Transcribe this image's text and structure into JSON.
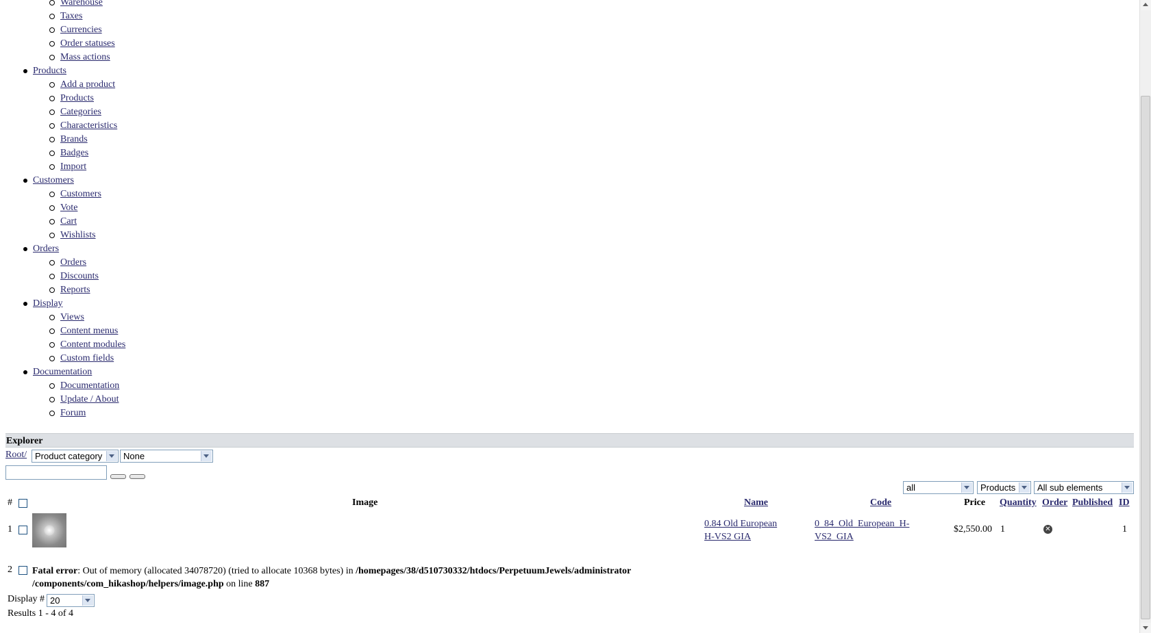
{
  "menu": [
    {
      "label": "Warehouse",
      "level": 2
    },
    {
      "label": "Taxes",
      "level": 2
    },
    {
      "label": "Currencies",
      "level": 2
    },
    {
      "label": "Order statuses",
      "level": 2
    },
    {
      "label": "Mass actions",
      "level": 2
    },
    {
      "label": "Products",
      "level": 1
    },
    {
      "label": "Add a product",
      "level": 2
    },
    {
      "label": "Products",
      "level": 2
    },
    {
      "label": "Categories",
      "level": 2
    },
    {
      "label": "Characteristics",
      "level": 2
    },
    {
      "label": "Brands",
      "level": 2
    },
    {
      "label": "Badges",
      "level": 2
    },
    {
      "label": "Import",
      "level": 2
    },
    {
      "label": "Customers",
      "level": 1
    },
    {
      "label": "Customers",
      "level": 2
    },
    {
      "label": "Vote",
      "level": 2
    },
    {
      "label": "Cart",
      "level": 2
    },
    {
      "label": "Wishlists",
      "level": 2
    },
    {
      "label": "Orders",
      "level": 1
    },
    {
      "label": "Orders",
      "level": 2
    },
    {
      "label": "Discounts",
      "level": 2
    },
    {
      "label": "Reports",
      "level": 2
    },
    {
      "label": "Display",
      "level": 1
    },
    {
      "label": "Views",
      "level": 2
    },
    {
      "label": "Content menus",
      "level": 2
    },
    {
      "label": "Content modules",
      "level": 2
    },
    {
      "label": "Custom fields",
      "level": 2
    },
    {
      "label": "Documentation",
      "level": 1
    },
    {
      "label": "Documentation",
      "level": 2
    },
    {
      "label": "Update / About",
      "level": 2
    },
    {
      "label": "Forum",
      "level": 2
    }
  ],
  "explorer": {
    "title": "Explorer",
    "root_link": "Root/",
    "category_type_select": "Product category",
    "category_select": "None",
    "search_value": ""
  },
  "filters": {
    "published": "all",
    "type": "Products",
    "depth": "All sub elements"
  },
  "table": {
    "headers": {
      "num": "#",
      "image": "Image",
      "name": "Name",
      "code": "Code",
      "price": "Price",
      "quantity": "Quantity",
      "order": "Order",
      "published": "Published",
      "id": "ID"
    },
    "rows": [
      {
        "num": "1",
        "name_line1": "0.84 Old European",
        "name_line2": "H-VS2 GIA",
        "code_line1": "0_84_Old_European_H-",
        "code_line2": "VS2_GIA",
        "price": "$2,550.00",
        "quantity": "1",
        "published_icon": "unpublished-x-icon",
        "id": "1"
      }
    ],
    "error_row": {
      "num": "2",
      "label": "Fatal error",
      "message": ": Out of memory (allocated 34078720) (tried to allocate 10368 bytes) in ",
      "path_line1": "/homepages/38/d510730332/htdocs/PerpetuumJewels/administrator",
      "path_line2": "/components/com_hikashop/helpers/image.php",
      "on_line_text": " on line ",
      "line_number": "887"
    }
  },
  "footer": {
    "display_label": "Display #",
    "display_value": "20",
    "results": "Results 1 - 4 of 4"
  }
}
